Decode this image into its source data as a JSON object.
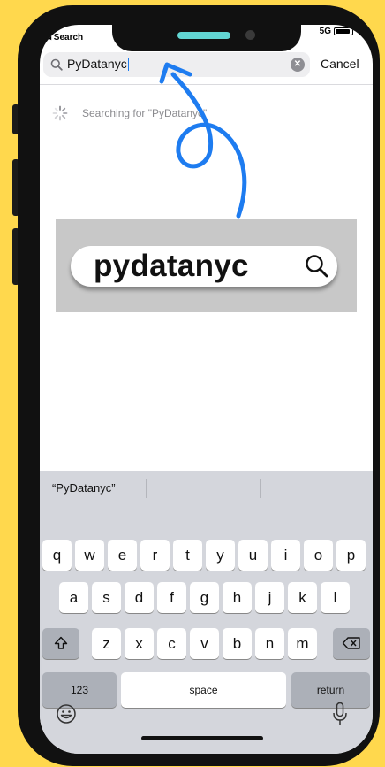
{
  "status_bar": {
    "back_label": "◂ Search",
    "network": "5G"
  },
  "search": {
    "query": "PyDatanyc",
    "cancel_label": "Cancel"
  },
  "results": {
    "status_text": "Searching for \"PyDatanyc\""
  },
  "overlay": {
    "logo_text": "pydatanyc",
    "arrow_color": "#1E7CF0",
    "card_color": "#C8C8C8"
  },
  "keyboard": {
    "suggestions": [
      "“PyDatanyc”",
      "",
      ""
    ],
    "row1": [
      "q",
      "w",
      "e",
      "r",
      "t",
      "y",
      "u",
      "i",
      "o",
      "p"
    ],
    "row2": [
      "a",
      "s",
      "d",
      "f",
      "g",
      "h",
      "j",
      "k",
      "l"
    ],
    "row3": [
      "z",
      "x",
      "c",
      "v",
      "b",
      "n",
      "m"
    ],
    "numbers_label": "123",
    "space_label": "space",
    "return_label": "return"
  },
  "colors": {
    "background": "#FFD84D",
    "accent": "#62D6D3"
  }
}
